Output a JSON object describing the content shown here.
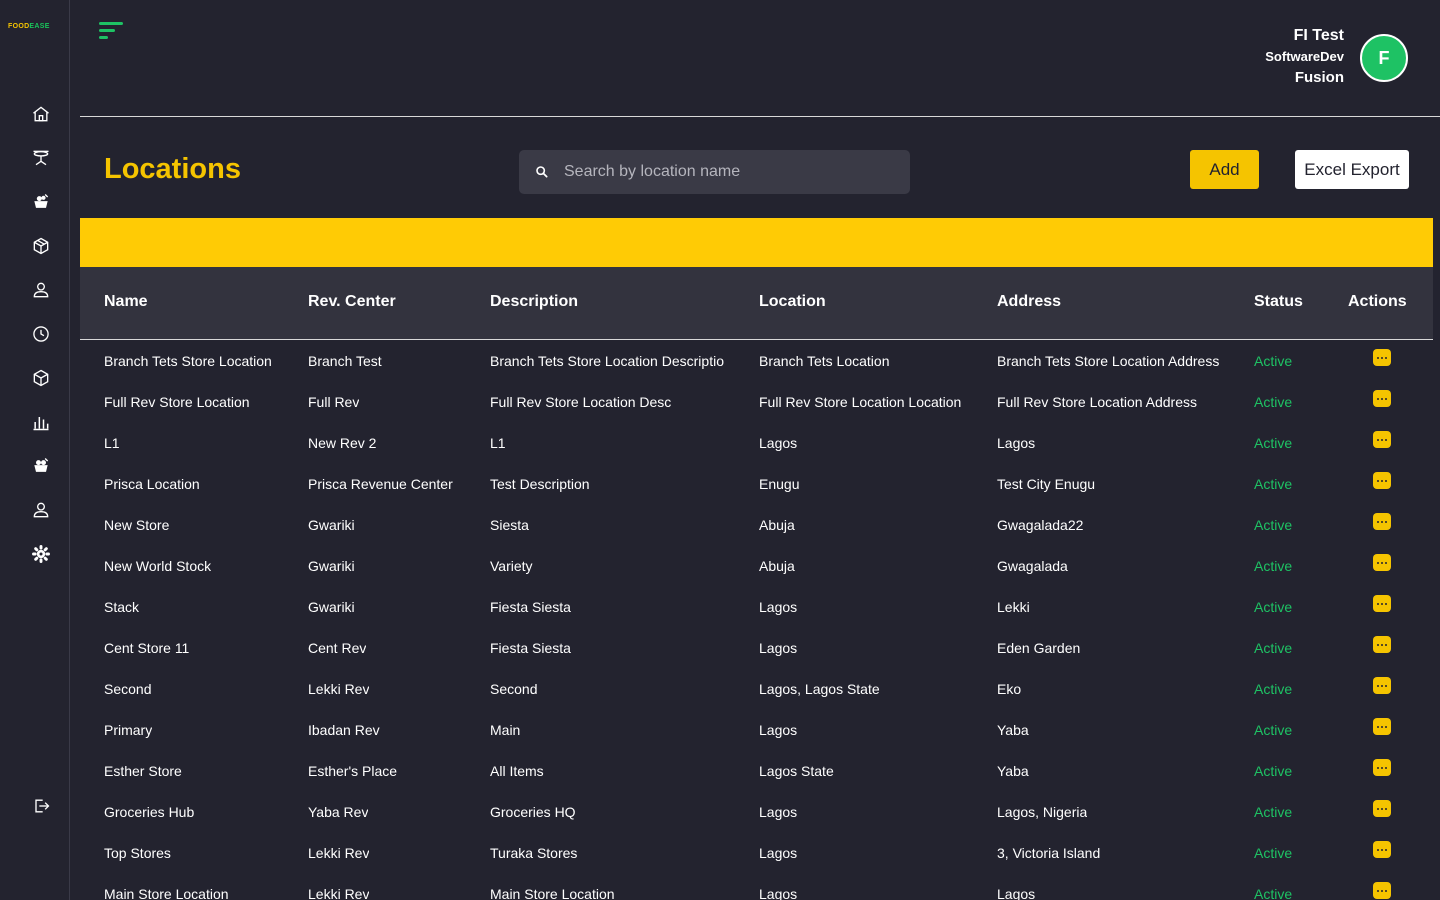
{
  "logo": {
    "part1": "FOOD",
    "part2": "EASE"
  },
  "sidebar": {
    "icons": [
      "home-icon",
      "dining-icon",
      "ingredients-icon",
      "package-icon",
      "user-icon",
      "clock-icon",
      "box-icon",
      "bar-chart-icon",
      "groceries-icon",
      "account-icon",
      "settings-icon"
    ],
    "logout_icon": "logout-icon"
  },
  "user": {
    "name": "FI Test",
    "company": "SoftwareDev",
    "org": "Fusion",
    "initial": "F"
  },
  "page": {
    "title": "Locations"
  },
  "search": {
    "placeholder": "Search by location name"
  },
  "actions": {
    "add_label": "Add",
    "export_label": "Excel Export"
  },
  "colors": {
    "accent": "#f5c400",
    "success": "#1ec264",
    "background": "#23232f"
  },
  "table": {
    "headers": [
      "Name",
      "Rev. Center",
      "Description",
      "Location",
      "Address",
      "Status",
      "Actions"
    ],
    "rows": [
      [
        "Branch Tets Store Location",
        "Branch Test",
        "Branch Tets Store Location Descriptio",
        "Branch Tets Location",
        "Branch Tets Store Location Address",
        "Active"
      ],
      [
        "Full Rev Store Location",
        "Full Rev",
        "Full Rev Store Location Desc",
        "Full Rev Store Location Location",
        "Full Rev Store Location Address",
        "Active"
      ],
      [
        "L1",
        "New Rev 2",
        "L1",
        "Lagos",
        "Lagos",
        "Active"
      ],
      [
        "Prisca Location",
        "Prisca Revenue Center",
        "Test Description",
        "Enugu",
        "Test City Enugu",
        "Active"
      ],
      [
        "New Store",
        "Gwariki",
        "Siesta",
        "Abuja",
        "Gwagalada22",
        "Active"
      ],
      [
        "New World Stock",
        "Gwariki",
        "Variety",
        "Abuja",
        "Gwagalada",
        "Active"
      ],
      [
        "Stack",
        "Gwariki",
        "Fiesta Siesta",
        "Lagos",
        "Lekki",
        "Active"
      ],
      [
        "Cent Store 11",
        "Cent Rev",
        "Fiesta Siesta",
        "Lagos",
        "Eden Garden",
        "Active"
      ],
      [
        "Second",
        "Lekki Rev",
        "Second",
        "Lagos, Lagos State",
        "Eko",
        "Active"
      ],
      [
        "Primary",
        "Ibadan Rev",
        "Main",
        "Lagos",
        "Yaba",
        "Active"
      ],
      [
        "Esther Store",
        "Esther's Place",
        "All Items",
        "Lagos State",
        "Yaba",
        "Active"
      ],
      [
        "Groceries Hub",
        "Yaba Rev",
        "Groceries HQ",
        "Lagos",
        "Lagos, Nigeria",
        "Active"
      ],
      [
        "Top Stores",
        "Lekki Rev",
        "Turaka Stores",
        "Lagos",
        "3, Victoria Island",
        "Active"
      ],
      [
        "Main Store Location",
        "Lekki Rev",
        "Main Store Location",
        "Lagos",
        "Lagos",
        "Active"
      ]
    ]
  }
}
